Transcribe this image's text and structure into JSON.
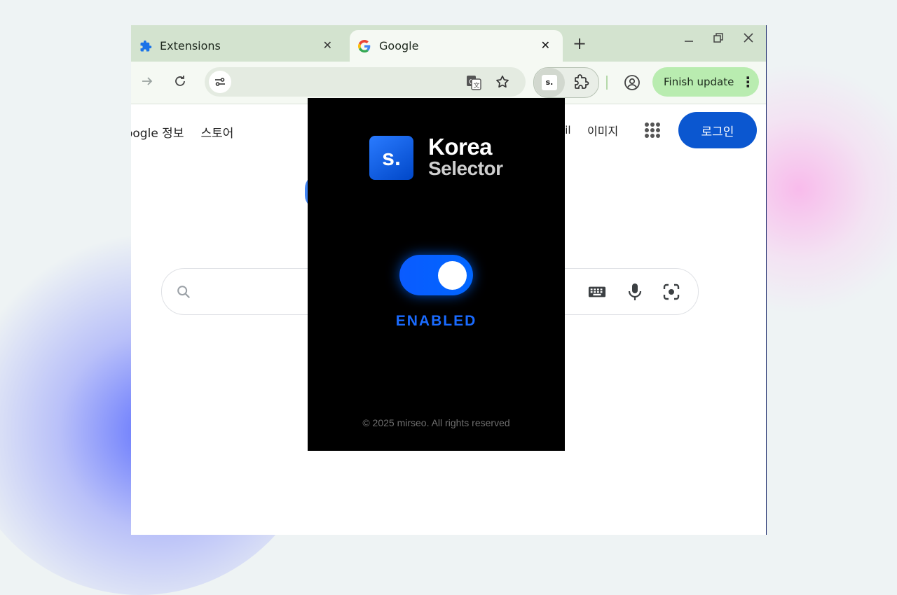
{
  "browser": {
    "tabs": [
      {
        "label": "Extensions",
        "icon": "puzzle-icon"
      },
      {
        "label": "Google",
        "icon": "google-g-icon",
        "active": true
      }
    ],
    "close_glyph": "✕",
    "new_tab_glyph": "+",
    "finish_update_label": "Finish update",
    "extension_badge": "s."
  },
  "page": {
    "nav_left": [
      "oogle 정보",
      "스토어"
    ],
    "nav_right_partial": "ail",
    "nav_images": "이미지",
    "login_label": "로그인"
  },
  "popup": {
    "logo_text": "s.",
    "title_line1": "Korea",
    "title_line2": "Selector",
    "toggle_on": true,
    "status_label": "ENABLED",
    "copyright": "© 2025 mirseo. All rights reserved"
  },
  "colors": {
    "accent": "#0b57d0",
    "popup_accent": "#1a6bff",
    "tabstrip": "#d3e3cf",
    "finish_update_bg": "#b9ecb0"
  }
}
